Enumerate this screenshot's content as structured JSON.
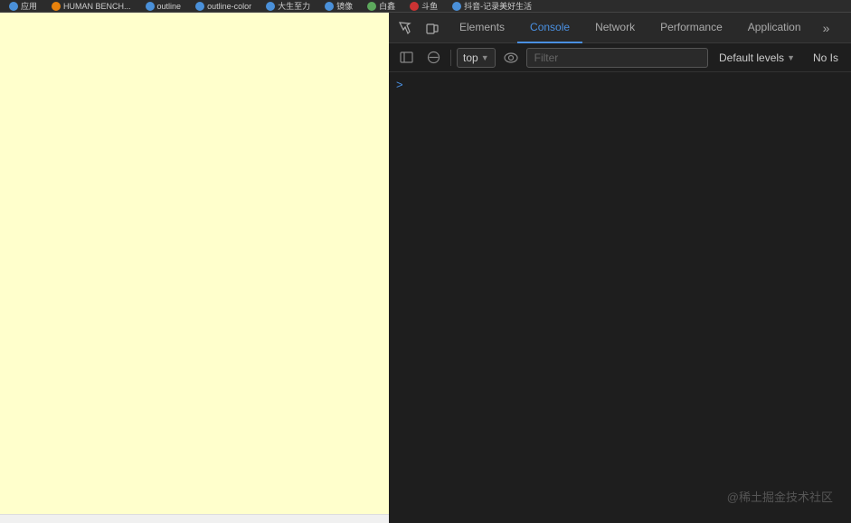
{
  "tabbar": {
    "tabs": [
      {
        "label": "应用",
        "icon": "app-icon",
        "iconClass": "icon-blue"
      },
      {
        "label": "HUMAN BENCH...",
        "icon": "bench-icon",
        "iconClass": "icon-orange"
      },
      {
        "label": "outline",
        "icon": "outline-icon",
        "iconClass": "icon-blue"
      },
      {
        "label": "outline-color",
        "icon": "outline-color-icon",
        "iconClass": "icon-blue"
      },
      {
        "label": "大生至力",
        "icon": "icon5",
        "iconClass": "icon-blue"
      },
      {
        "label": "镜像",
        "icon": "icon6",
        "iconClass": "icon-blue"
      },
      {
        "label": "白鑫",
        "icon": "icon7",
        "iconClass": "icon-green"
      },
      {
        "label": "斗鱼",
        "icon": "icon8",
        "iconClass": "icon-red"
      },
      {
        "label": "抖音-记录美好生活",
        "icon": "icon9",
        "iconClass": "icon-blue"
      }
    ]
  },
  "devtools": {
    "tabs": [
      {
        "id": "elements",
        "label": "Elements",
        "active": false
      },
      {
        "id": "console",
        "label": "Console",
        "active": true
      },
      {
        "id": "network",
        "label": "Network",
        "active": false
      },
      {
        "id": "performance",
        "label": "Performance",
        "active": false
      },
      {
        "id": "application",
        "label": "Application",
        "active": false
      }
    ],
    "more_label": "»"
  },
  "console": {
    "top_selector": "top",
    "top_chevron": "▼",
    "filter_placeholder": "Filter",
    "default_levels": "Default levels",
    "default_levels_chevron": "▼",
    "no_issues": "No Is",
    "prompt_arrow": ">"
  },
  "toolbar": {
    "icons": {
      "sidebar": "▣",
      "clear": "🚫",
      "eye": "👁"
    }
  },
  "watermark": {
    "text": "@稀土掘金技术社区"
  }
}
